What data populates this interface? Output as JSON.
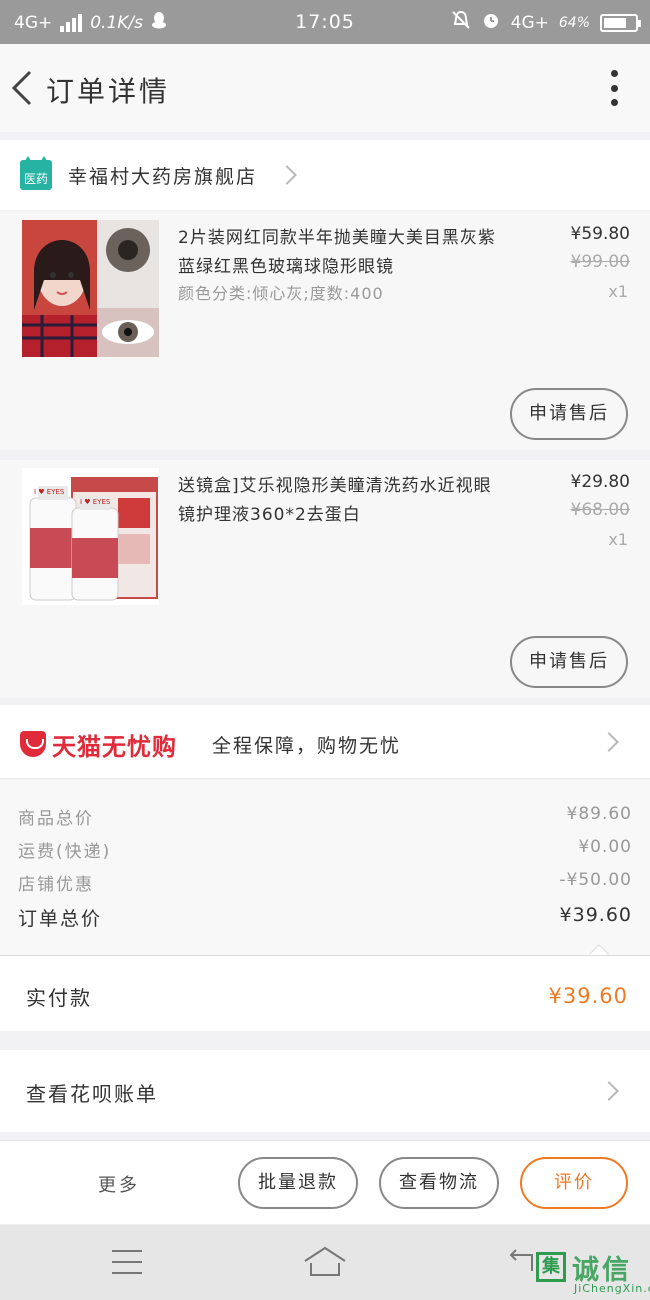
{
  "status_bar": {
    "network_left": "4G+",
    "speed": "0.1K/s",
    "time": "17:05",
    "network_right": "4G+",
    "battery": "64%"
  },
  "header": {
    "title": "订单详情"
  },
  "shop": {
    "name": "幸福村大药房旗舰店",
    "logo_text": "医药"
  },
  "items": [
    {
      "title": "2片装网红同款半年抛美瞳大美目黑灰紫蓝绿红黑色玻璃球隐形眼镜",
      "sku": "颜色分类:倾心灰;度数:400",
      "price": "¥59.80",
      "original_price": "¥99.00",
      "quantity": "x1",
      "action": "申请售后"
    },
    {
      "title": "送镜盒]艾乐视隐形美瞳清洗药水近视眼镜护理液360*2去蛋白",
      "sku": "",
      "price": "¥29.80",
      "original_price": "¥68.00",
      "quantity": "x1",
      "action": "申请售后"
    }
  ],
  "guarantee": {
    "brand": "天猫无忧购",
    "description": "全程保障，购物无忧"
  },
  "summary": {
    "rows": [
      {
        "label": "商品总价",
        "value": "¥89.60"
      },
      {
        "label": "运费(快递)",
        "value": "¥0.00"
      },
      {
        "label": "店铺优惠",
        "value": "-¥50.00"
      }
    ],
    "total_label": "订单总价",
    "total_value": "¥39.60"
  },
  "payment": {
    "label": "实付款",
    "value": "¥39.60"
  },
  "huabei": {
    "label": "查看花呗账单"
  },
  "actions": {
    "more": "更多",
    "refund": "批量退款",
    "logistics": "查看物流",
    "review": "评价"
  },
  "watermark": {
    "box_char": "集",
    "name": "诚信",
    "domain": "JiChengXin.com"
  },
  "colors": {
    "accent": "#f07a24",
    "tmall_red": "#e02b3b",
    "shop_logo": "#27b3a4"
  }
}
